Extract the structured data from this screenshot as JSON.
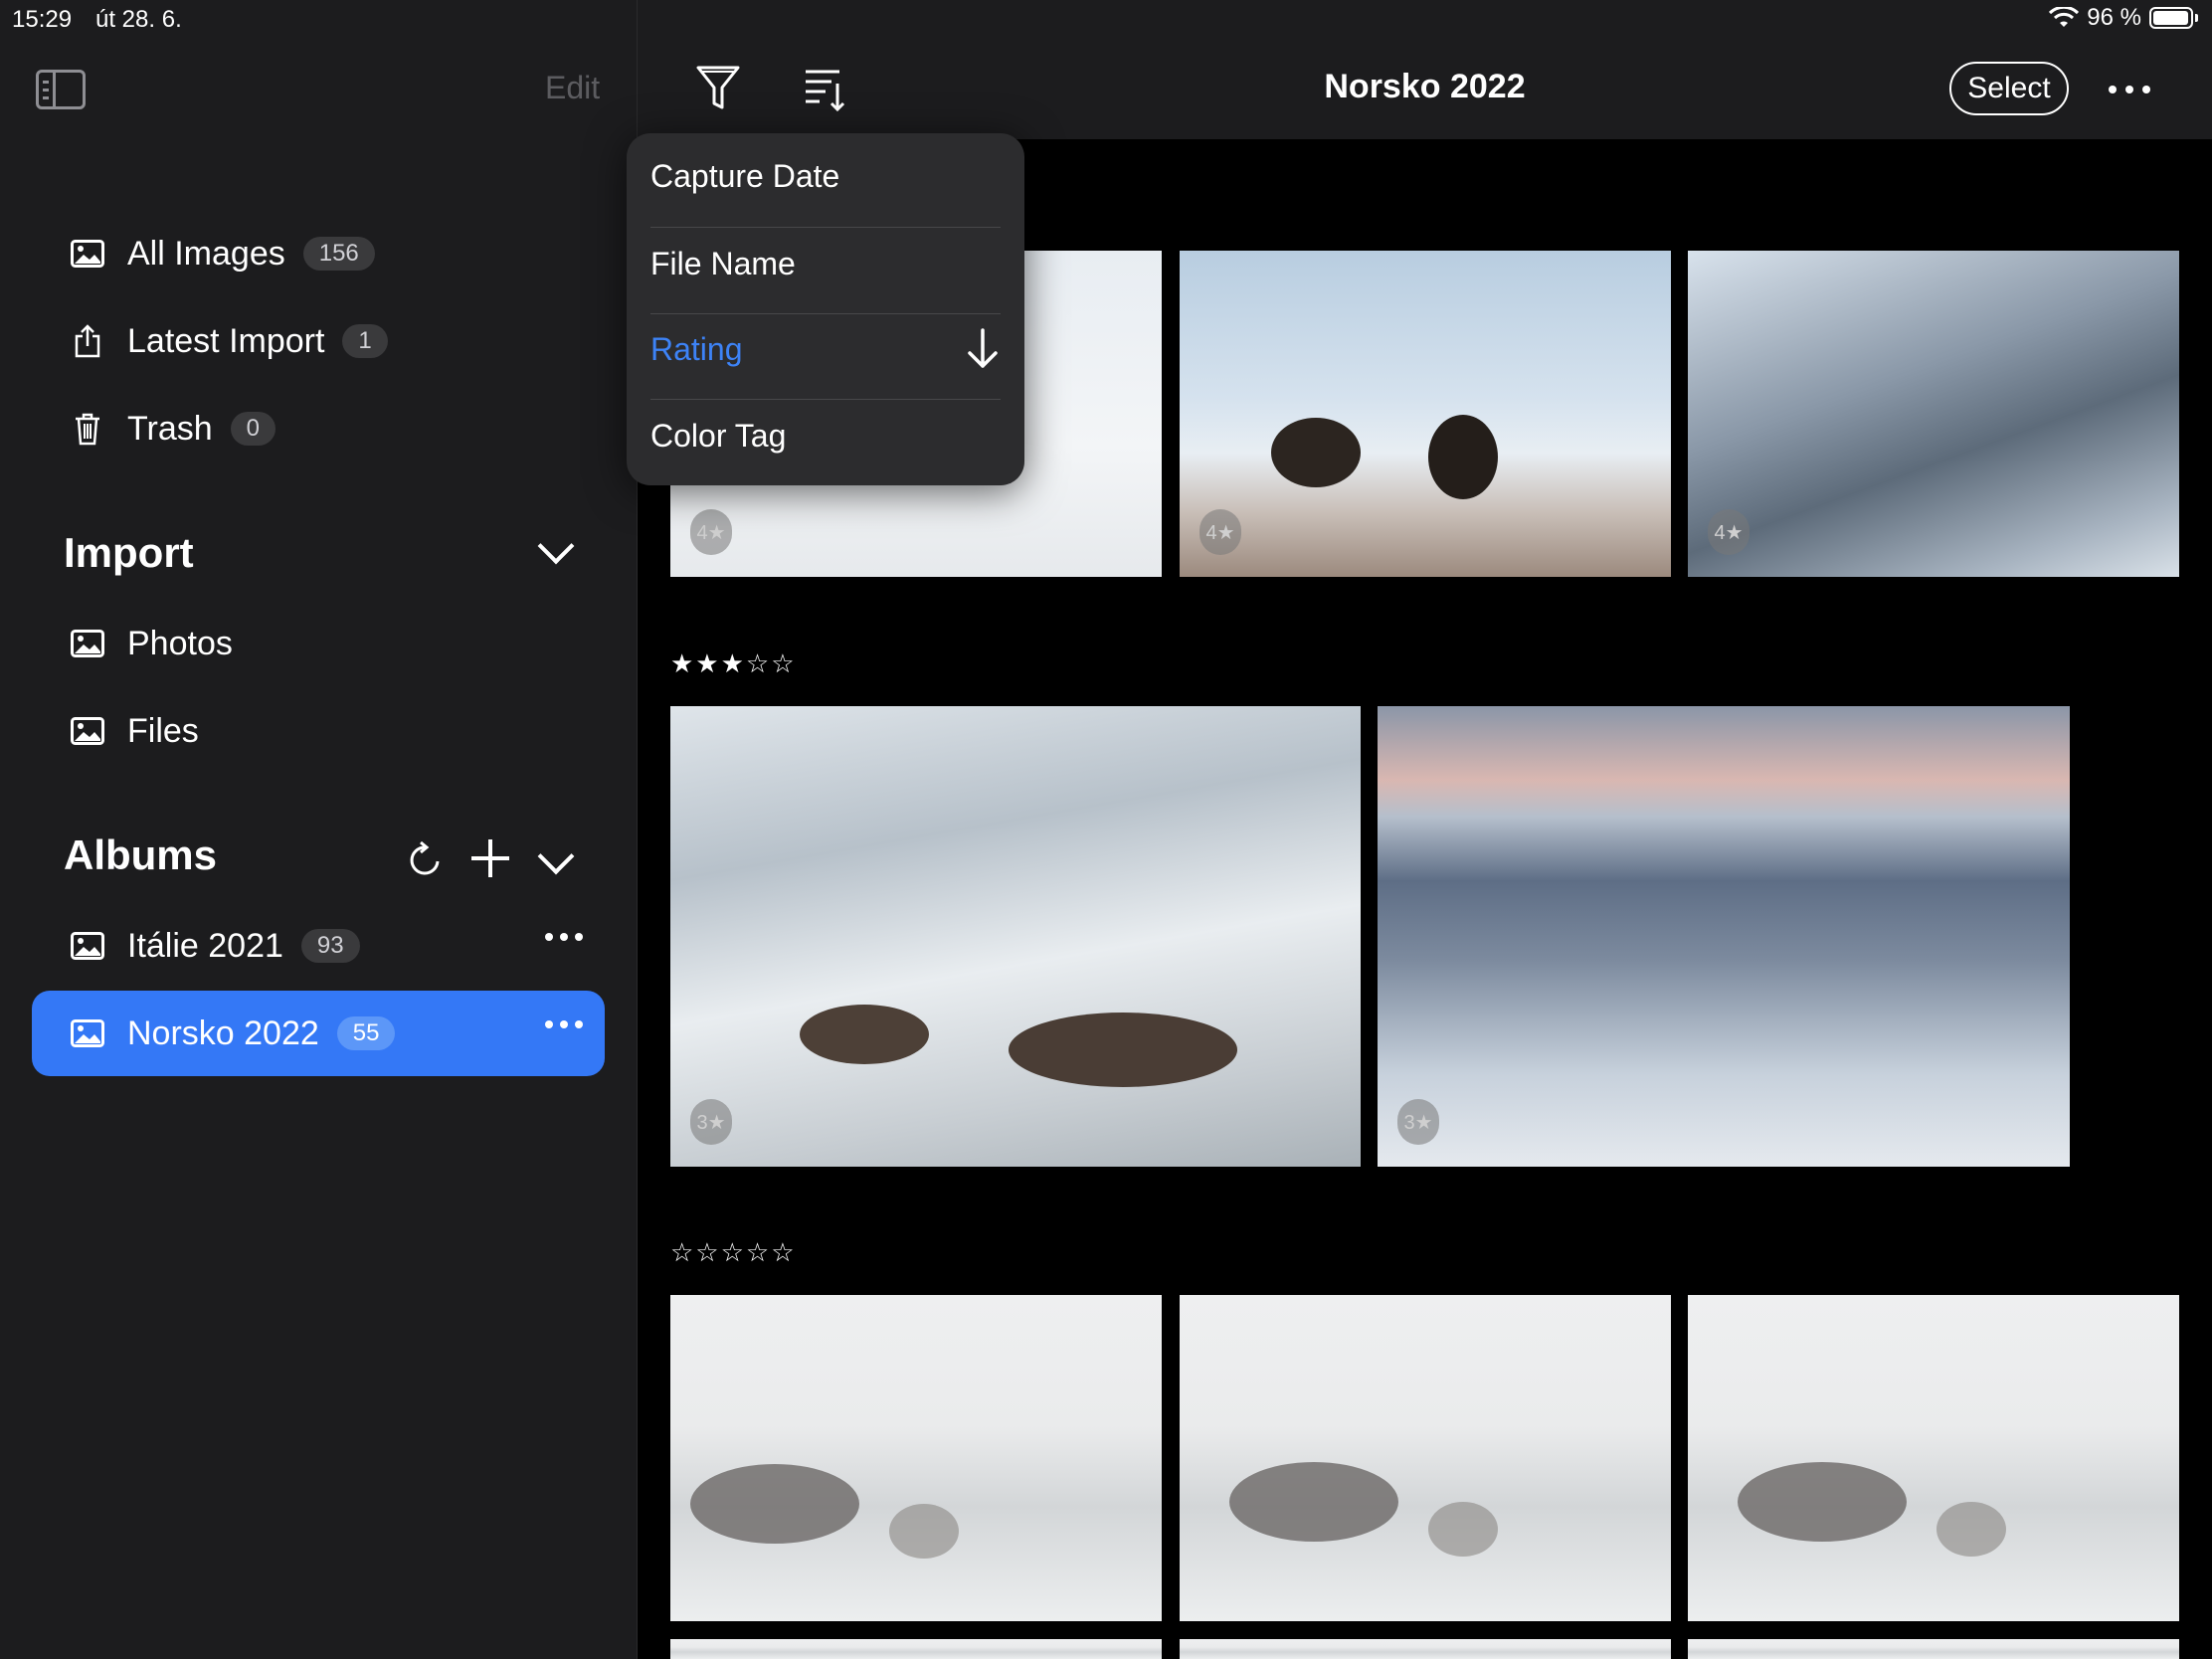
{
  "status_bar": {
    "time": "15:29",
    "date": "út 28. 6.",
    "battery_text": "96 %",
    "battery_level": 0.96
  },
  "sidebar": {
    "edit_label": "Edit",
    "library": [
      {
        "label": "All Images",
        "count": "156",
        "icon": "image-icon"
      },
      {
        "label": "Latest Import",
        "count": "1",
        "icon": "share-icon"
      },
      {
        "label": "Trash",
        "count": "0",
        "icon": "trash-icon"
      }
    ],
    "import_section": {
      "title": "Import",
      "items": [
        {
          "label": "Photos"
        },
        {
          "label": "Files"
        }
      ]
    },
    "albums_section": {
      "title": "Albums",
      "items": [
        {
          "label": "Itálie 2021",
          "count": "93",
          "selected": false
        },
        {
          "label": "Norsko 2022",
          "count": "55",
          "selected": true
        }
      ]
    }
  },
  "toolbar": {
    "title": "Norsko 2022",
    "select_label": "Select"
  },
  "sort_menu": {
    "items": [
      {
        "label": "Capture Date",
        "selected": false
      },
      {
        "label": "File Name",
        "selected": false
      },
      {
        "label": "Rating",
        "selected": true,
        "direction": "descending"
      },
      {
        "label": "Color Tag",
        "selected": false
      }
    ]
  },
  "groups": [
    {
      "stars_text": "",
      "rating": 4,
      "photos": [
        {
          "badge": "4★"
        },
        {
          "badge": "4★"
        },
        {
          "badge": "4★"
        }
      ]
    },
    {
      "stars_text": "★★★☆☆",
      "rating": 3,
      "photos": [
        {
          "badge": "3★"
        },
        {
          "badge": "3★"
        }
      ]
    },
    {
      "stars_text": "☆☆☆☆☆",
      "rating": 0,
      "photos": [
        {},
        {},
        {}
      ]
    }
  ],
  "colors": {
    "accent": "#3478f6",
    "sidebar_bg": "#1c1c1e",
    "menu_bg": "#2c2c2e"
  }
}
